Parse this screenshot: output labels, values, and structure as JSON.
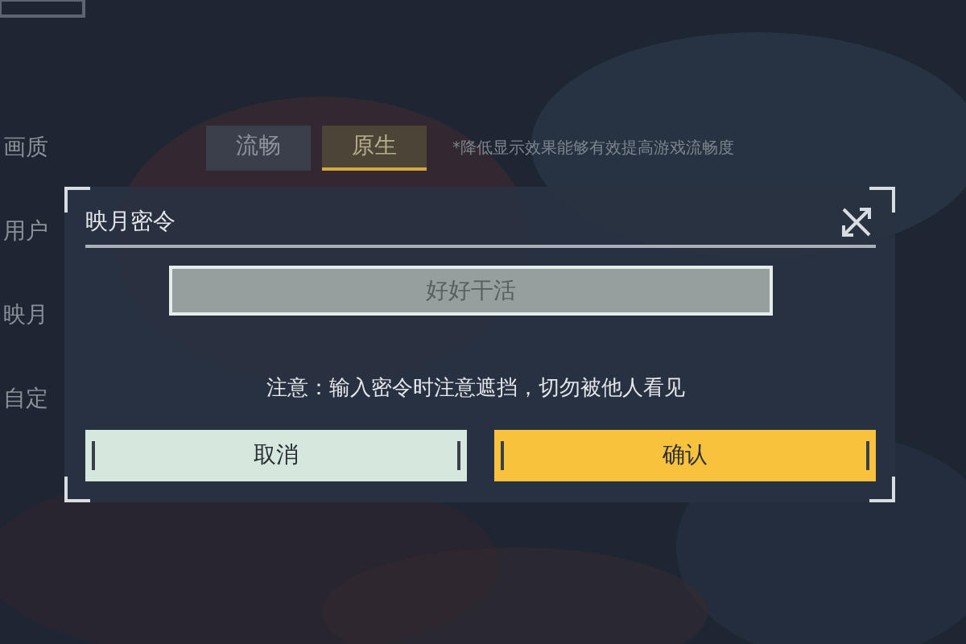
{
  "settings": {
    "rows": [
      {
        "label": "画质"
      },
      {
        "label": "用户"
      },
      {
        "label": "映月"
      },
      {
        "label": "自定"
      }
    ],
    "quality_options": [
      {
        "label": "流畅",
        "selected": false
      },
      {
        "label": "原生",
        "selected": true
      }
    ],
    "quality_hint": "*降低显示效果能够有效提高游戏流畅度"
  },
  "dialog": {
    "title": "映月密令",
    "input": {
      "value": "好好干活"
    },
    "notice": "注意：输入密令时注意遮挡，切勿被他人看见",
    "buttons": [
      {
        "label": "取消",
        "kind": "secondary"
      },
      {
        "label": "确认",
        "kind": "primary"
      }
    ]
  }
}
